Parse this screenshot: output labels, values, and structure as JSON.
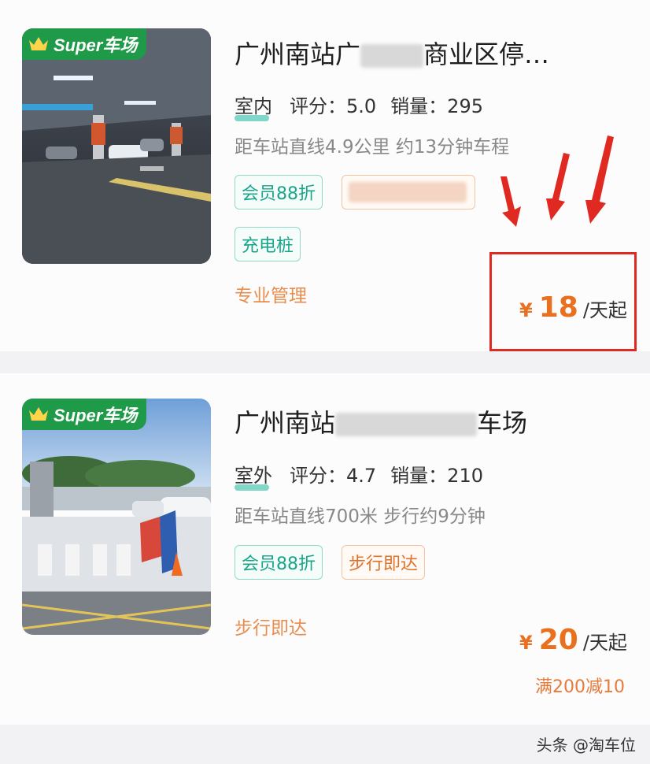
{
  "listings": [
    {
      "badge": "Super车场",
      "title_start": "广州南站广",
      "title_end": "商业区停…",
      "location": "室内",
      "rating_label": "评分：",
      "rating": "5.0",
      "sales_label": "销量：",
      "sales": "295",
      "distance": "距车站直线4.9公里 约13分钟车程",
      "tags": [
        "会员88折",
        "充电桩"
      ],
      "feature": "专业管理",
      "currency": "¥",
      "price": "18",
      "price_unit": "/天起"
    },
    {
      "badge": "Super车场",
      "title_start": "广州南站",
      "title_end": "车场",
      "location": "室外",
      "rating_label": "评分：",
      "rating": "4.7",
      "sales_label": "销量：",
      "sales": "210",
      "distance": "距车站直线700米 步行约9分钟",
      "tags": [
        "会员88折",
        "步行即达"
      ],
      "feature": "步行即达",
      "currency": "¥",
      "price": "20",
      "price_unit": "/天起",
      "discount": "满200减10"
    }
  ],
  "watermark": "头条 @淘车位",
  "colors": {
    "super_badge": "#1f9a48",
    "price": "#e8701f",
    "tag_green": "#18a58a",
    "tag_orange": "#e2722a",
    "annotation_red": "#e02a21"
  },
  "icons": [
    "crown-icon",
    "red-arrow-icon"
  ]
}
